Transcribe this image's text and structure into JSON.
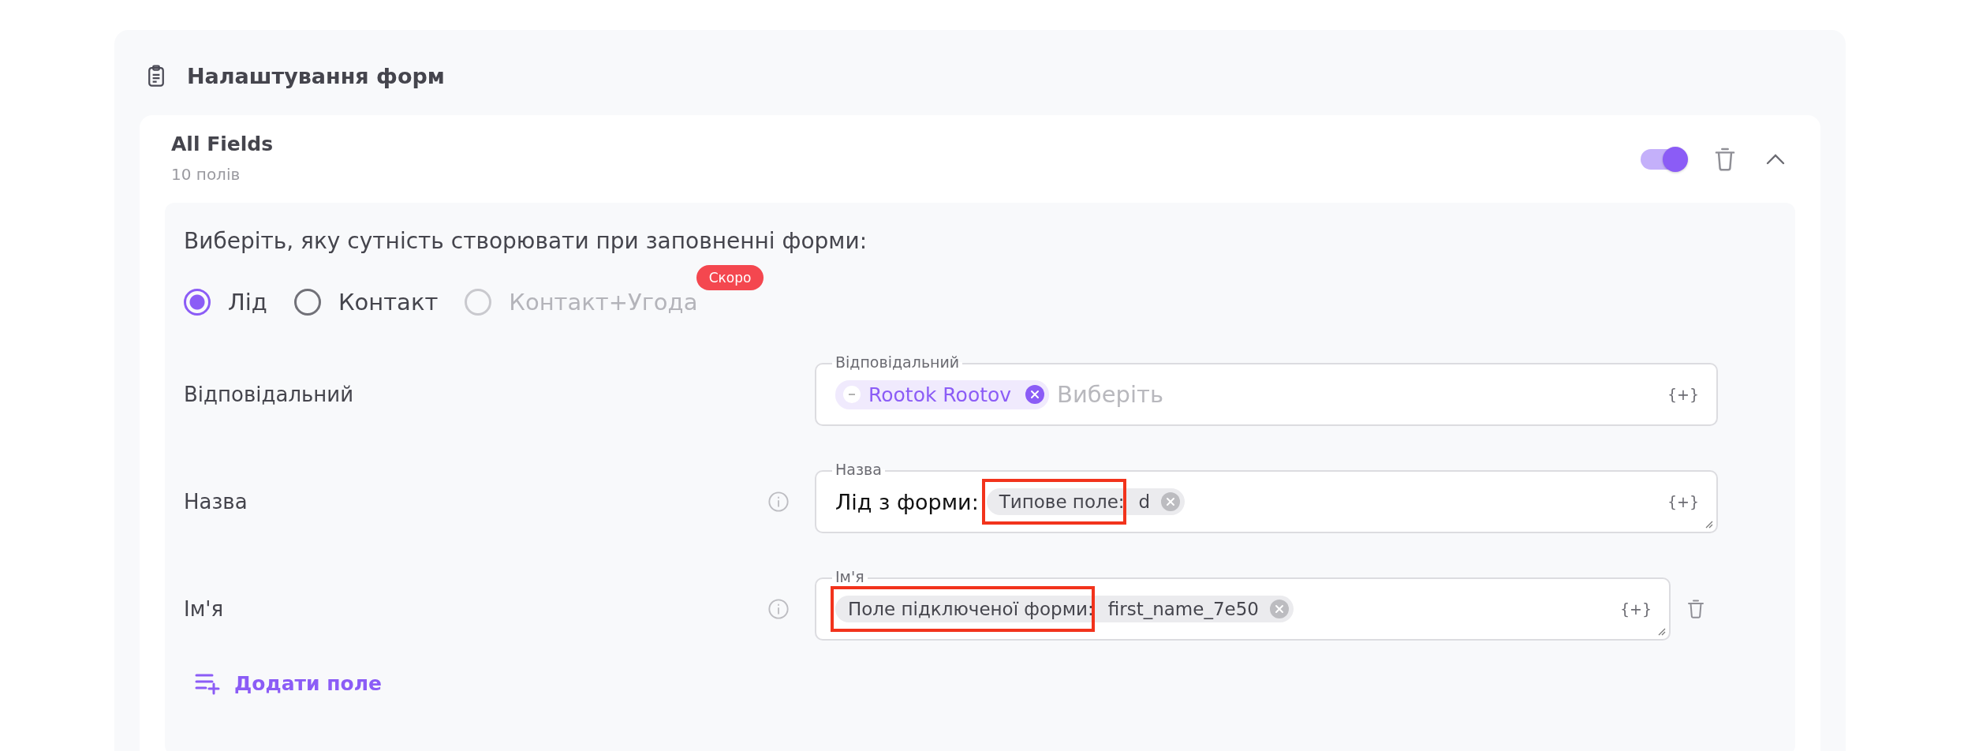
{
  "section": {
    "title": "Налаштування форм"
  },
  "form": {
    "name": "All Fields",
    "count": "10 полів",
    "enabled": true,
    "expanded": true
  },
  "entity": {
    "question": "Виберіть, яку сутність створювати при заповненні форми:",
    "options": [
      {
        "label": "Лід",
        "selected": true,
        "disabled": false
      },
      {
        "label": "Контакт",
        "selected": false,
        "disabled": false
      },
      {
        "label": "Контакт+Угода",
        "selected": false,
        "disabled": true,
        "badge": "Скоро"
      }
    ]
  },
  "fields": [
    {
      "label": "Відповідальний",
      "info": false,
      "removable": false,
      "resizable": false,
      "legend": "Відповідальний",
      "placeholder": "Виберіть",
      "insert": "{+}",
      "chips": [
        {
          "kind": "user",
          "value": "Rootok Rootov",
          "highlighted": false
        }
      ]
    },
    {
      "label": "Назва",
      "info": true,
      "removable": false,
      "resizable": true,
      "legend": "Назва",
      "text": "Лід з форми:",
      "insert": "{+}",
      "chips": [
        {
          "kind": "token",
          "prefix": "Типове поле:",
          "value": "d",
          "highlighted": true
        }
      ]
    },
    {
      "label": "Ім'я",
      "info": true,
      "removable": true,
      "resizable": true,
      "legend": "Ім'я",
      "insert": "{+}",
      "chips": [
        {
          "kind": "token",
          "prefix": "Поле підключеної форми:",
          "value": "first_name_7e50",
          "highlighted": true
        }
      ]
    }
  ],
  "add_button": "Додати поле"
}
